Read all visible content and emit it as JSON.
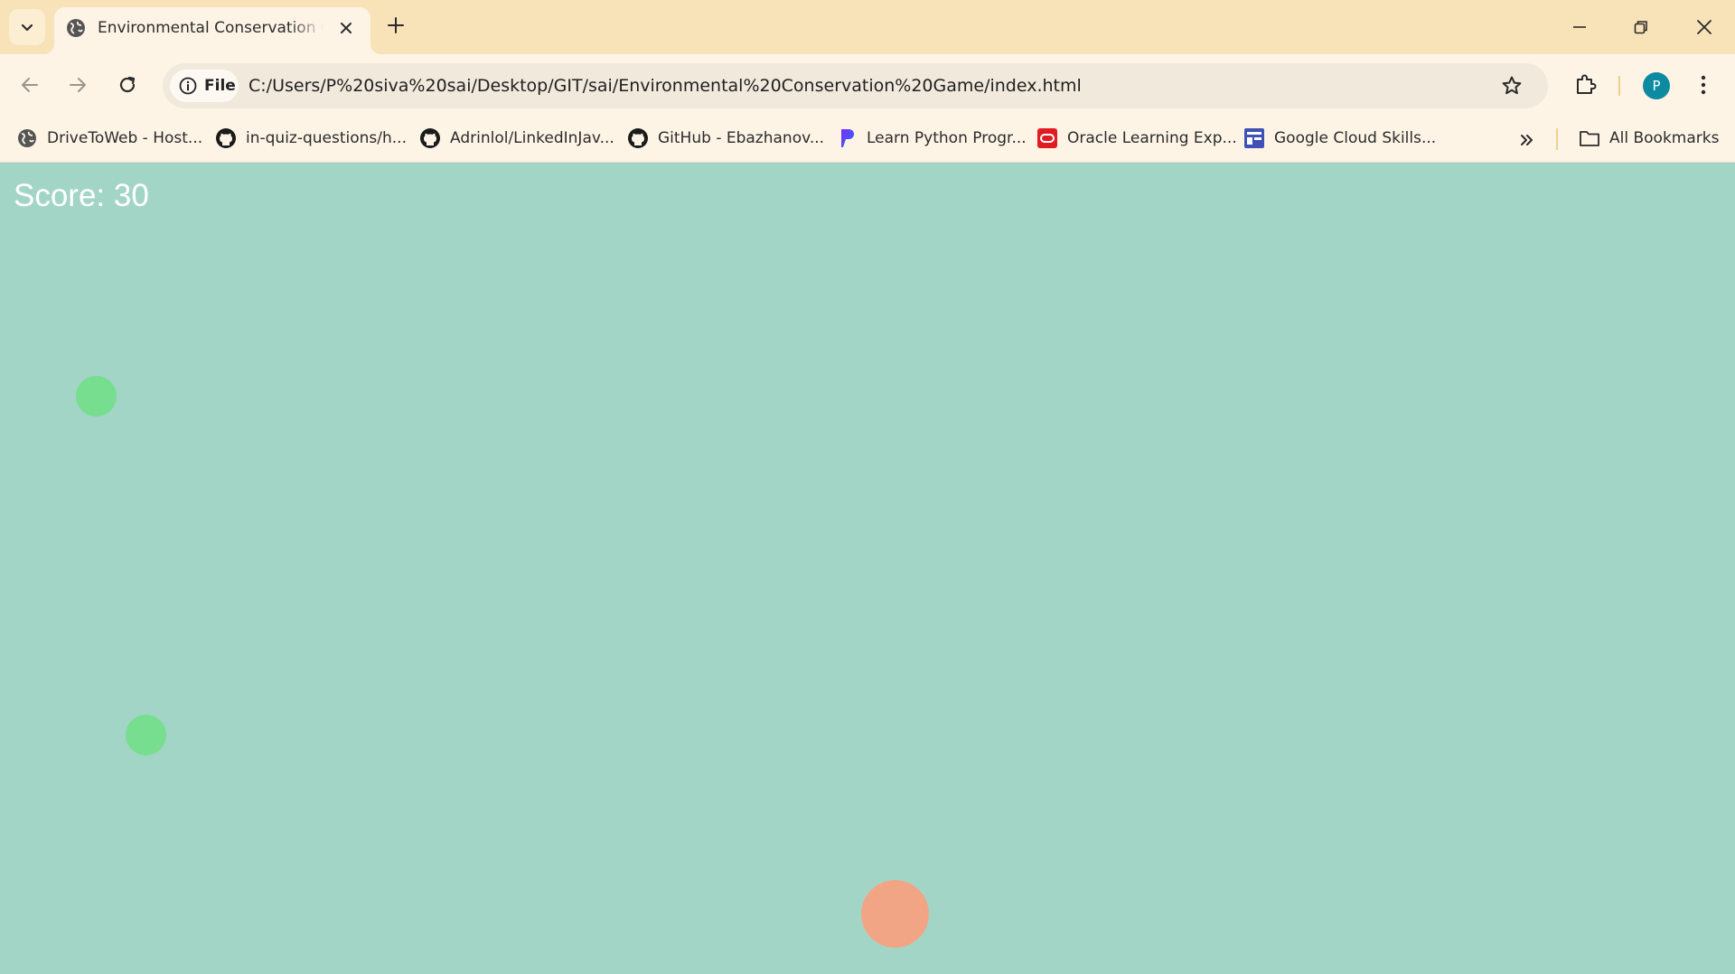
{
  "browser": {
    "tab": {
      "title": "Environmental Conservation Game"
    },
    "omnibox": {
      "chip_label": "File",
      "url": "C:/Users/P%20siva%20sai/Desktop/GIT/sai/Environmental%20Conservation%20Game/index.html"
    },
    "profile_initial": "P",
    "bookmarks": [
      {
        "label": "DriveToWeb - Host...",
        "icon": "globe-icon"
      },
      {
        "label": "in-quiz-questions/h...",
        "icon": "github-icon"
      },
      {
        "label": "Adrinlol/LinkedInJav...",
        "icon": "github-icon"
      },
      {
        "label": "GitHub - Ebazhanov...",
        "icon": "github-icon"
      },
      {
        "label": "Learn Python Progr...",
        "icon": "p-logo-icon"
      },
      {
        "label": "Oracle Learning Exp...",
        "icon": "oracle-icon"
      },
      {
        "label": "Google Cloud Skills...",
        "icon": "skills-icon"
      }
    ],
    "all_bookmarks_label": "All Bookmarks"
  },
  "game": {
    "score_text": "Score: 30",
    "colors": {
      "background": "#a3d5c6",
      "good_item": "#77dd8f",
      "player": "#f2a585",
      "score_text": "#ffffff"
    }
  }
}
